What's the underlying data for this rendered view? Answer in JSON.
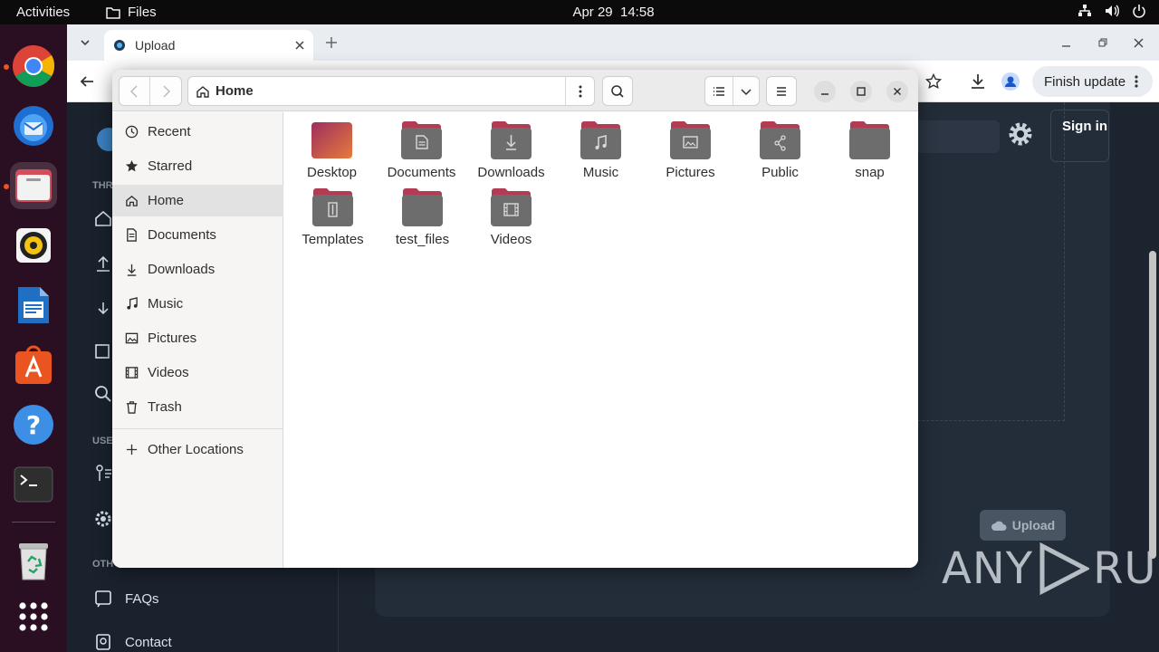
{
  "topbar": {
    "activities": "Activities",
    "app_name": "Files",
    "date": "Apr 29",
    "time": "14:58"
  },
  "dock": {
    "items": [
      {
        "name": "Google Chrome",
        "icon": "chrome-icon"
      },
      {
        "name": "Thunderbird",
        "icon": "thunderbird-icon"
      },
      {
        "name": "Files",
        "icon": "files-icon"
      },
      {
        "name": "Rhythmbox",
        "icon": "rhythmbox-icon"
      },
      {
        "name": "LibreOffice Writer",
        "icon": "writer-icon"
      },
      {
        "name": "Ubuntu Software",
        "icon": "software-icon"
      },
      {
        "name": "Help",
        "icon": "help-icon"
      },
      {
        "name": "Terminal",
        "icon": "terminal-icon"
      },
      {
        "name": "Trash",
        "icon": "trash-icon"
      },
      {
        "name": "Show Applications",
        "icon": "app-grid-icon"
      }
    ]
  },
  "browser": {
    "tab_title": "Upload",
    "finish_update": "Finish update"
  },
  "website": {
    "section_labels": [
      "THR",
      "USE",
      "OTH"
    ],
    "links": [
      "FAQs",
      "Contact"
    ],
    "sign_in": "Sign in",
    "upload_button": "Upload",
    "watermark_left": "ANY",
    "watermark_right": "RUN"
  },
  "files": {
    "location": "Home",
    "sidebar": {
      "recent": "Recent",
      "starred": "Starred",
      "home": "Home",
      "documents": "Documents",
      "downloads": "Downloads",
      "music": "Music",
      "pictures": "Pictures",
      "videos": "Videos",
      "trash": "Trash",
      "other_locations": "Other Locations"
    },
    "folders": {
      "desktop": "Desktop",
      "documents": "Documents",
      "downloads": "Downloads",
      "music": "Music",
      "pictures": "Pictures",
      "public": "Public",
      "snap": "snap",
      "templates": "Templates",
      "test_files": "test_files",
      "videos": "Videos"
    }
  },
  "colors": {
    "dock_bg": "#2a0e22",
    "folder_top": "#b33c55",
    "folder_body": "#6d6d6d",
    "accent": "#e95420"
  }
}
